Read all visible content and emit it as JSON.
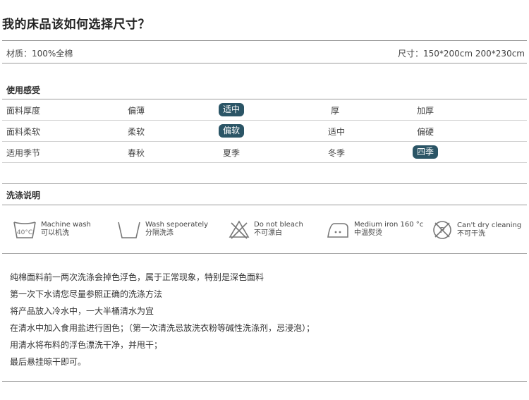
{
  "title": "我的床品该如何选择尺寸？",
  "material": "材质：100%全棉",
  "size": "尺寸：150*200cm  200*230cm",
  "usage": {
    "heading": "使用感受",
    "rows": [
      {
        "label": "面料厚度",
        "options": [
          "偏薄",
          "适中",
          "厚",
          "加厚"
        ],
        "selected": 1
      },
      {
        "label": "面料柔软",
        "options": [
          "柔软",
          "偏软",
          "适中",
          "偏硬"
        ],
        "selected": 1
      },
      {
        "label": "适用季节",
        "options": [
          "春秋",
          "夏季",
          "冬季",
          "四季"
        ],
        "selected": 3
      }
    ],
    "highlight_color": "#2b5566"
  },
  "washing": {
    "heading": "洗涤说明",
    "items": [
      {
        "icon": "wash-40-icon",
        "icon_text": "40°C",
        "en": "Machine wash",
        "cn": "可以机洗"
      },
      {
        "icon": "wash-tub-icon",
        "en": "Wash sepoerately",
        "cn": "分隔洗涤"
      },
      {
        "icon": "no-bleach-icon",
        "en": "Do not bleach",
        "cn": "不可漂白"
      },
      {
        "icon": "iron-icon",
        "en": "Medium iron 160 °c",
        "cn": "中温熨烫"
      },
      {
        "icon": "no-dry-clean-icon",
        "en": "Can't dry cleaning",
        "cn": "不可干洗"
      }
    ]
  },
  "notes": [
    "纯棉面料前一两次洗涤会掉色浮色，属于正常现象，特别是深色面料",
    "第一次下水请您尽量参照正确的洗涤方法",
    "将产品放入冷水中，一大半桶清水为宜",
    "在清水中加入食用盐进行固色；（第一次清洗忌放洗衣粉等碱性洗涤剂，忌浸泡）；",
    "用清水将布料的浮色漂洗干净，并甩干；",
    "最后悬挂晾干即可。"
  ]
}
